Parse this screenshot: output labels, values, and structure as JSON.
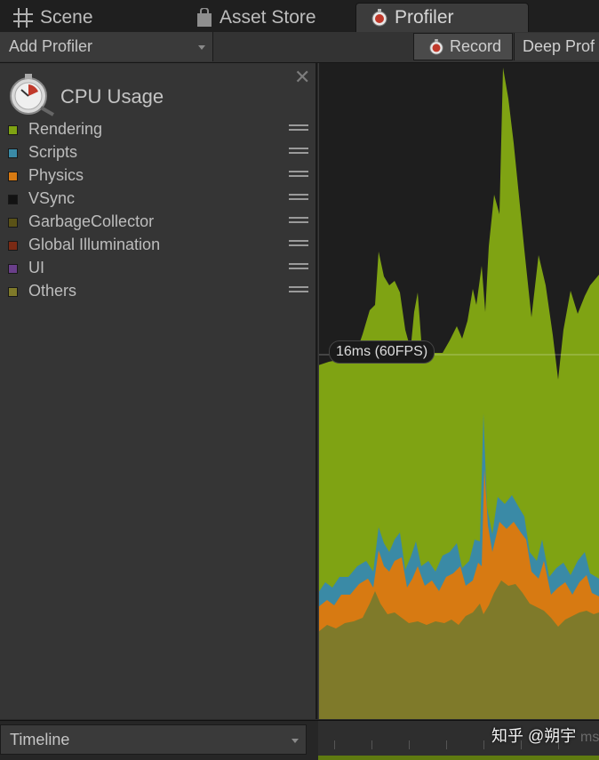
{
  "tabs": [
    {
      "label": "Scene",
      "icon": "grid-icon"
    },
    {
      "label": "Asset Store",
      "icon": "bag-icon"
    },
    {
      "label": "Profiler",
      "icon": "profiler-icon",
      "active": true
    }
  ],
  "toolbar": {
    "add_profiler_label": "Add Profiler",
    "record_label": "Record",
    "deep_profile_label": "Deep Prof"
  },
  "cpu_panel": {
    "title": "CPU Usage",
    "legend": [
      {
        "label": "Rendering",
        "color": "#7fa313"
      },
      {
        "label": "Scripts",
        "color": "#3a8aa6"
      },
      {
        "label": "Physics",
        "color": "#d77a12"
      },
      {
        "label": "VSync",
        "color": "#121212"
      },
      {
        "label": "GarbageCollector",
        "color": "#5a5217"
      },
      {
        "label": "Global Illumination",
        "color": "#7a2a14"
      },
      {
        "label": "UI",
        "color": "#6a3f8a"
      },
      {
        "label": "Others",
        "color": "#7f7a2a"
      }
    ]
  },
  "chart": {
    "fps_label": "16ms (60FPS)"
  },
  "bottom": {
    "view_mode_label": "Timeline",
    "ruler_unit": "ms"
  },
  "watermark": "知乎 @朔宇"
}
